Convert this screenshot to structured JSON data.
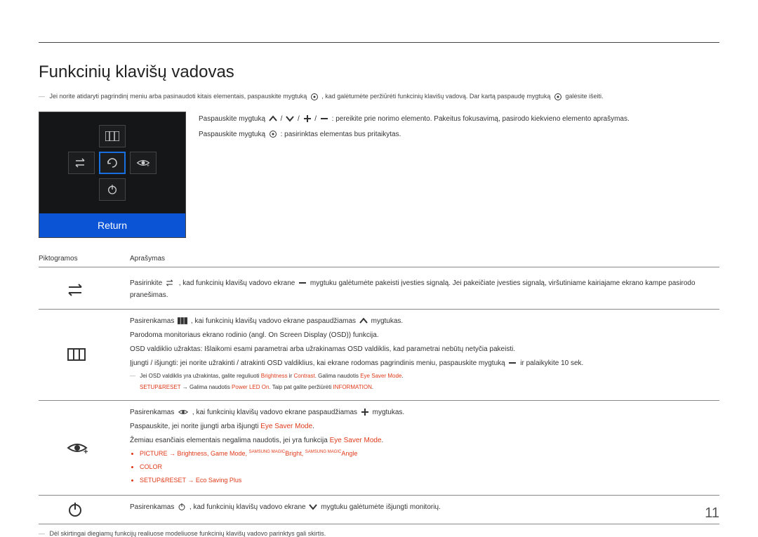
{
  "title": "Funkcinių klavišų vadovas",
  "intro": {
    "part1": "Jei norite atidaryti pagrindinį meniu arba pasinaudoti kitais elementais, paspauskite mygtuką",
    "part2": ", kad galėtumėte peržiūrėti funkcinių klavišų vadovą. Dar kartą paspaudę mygtuką",
    "part3": "galėsite išeiti."
  },
  "panel": {
    "return": "Return"
  },
  "side": {
    "line1_a": "Paspauskite mygtuką",
    "line1_b": ": pereikite prie norimo elemento. Pakeitus fokusavimą, pasirodo kiekvieno elemento aprašymas.",
    "line2_a": "Paspauskite mygtuką",
    "line2_b": ": pasirinktas elementas bus pritaikytas."
  },
  "table": {
    "h_icon": "Piktogramos",
    "h_desc": "Aprašymas",
    "row1": {
      "a": "Pasirinkite",
      "b": ", kad funkcinių klavišų vadovo ekrane",
      "c": "mygtuku galėtumėte pakeisti įvesties signalą. Jei pakeičiate įvesties signalą, viršutiniame kairiajame ekrano kampe pasirodo pranešimas."
    },
    "row2": {
      "a": "Pasirenkamas",
      "b": ", kai funkcinių klavišų vadovo ekrane paspaudžiamas",
      "c": "mygtukas.",
      "line2": "Parodoma monitoriaus ekrano rodinio (angl. On Screen Display (OSD)) funkcija.",
      "line3": "OSD valdiklio užraktas: Išlaikomi esami parametrai arba užrakinamas OSD valdiklis, kad parametrai nebūtų netyčia pakeisti.",
      "line4_a": "Įjungti / išjungti: jei norite užrakinti / atrakinti OSD valdiklius, kai ekrane rodomas pagrindinis meniu, paspauskite mygtuką",
      "line4_b": "ir palaikykite 10 sek.",
      "note_a": "Jei OSD valdiklis yra užrakintas, galite reguliuoti",
      "note_b": "Brightness",
      "note_c": "ir",
      "note_d": "Contrast",
      "note_e": ". Galima naudotis",
      "note_f": "Eye Saver Mode",
      "note2_a": "SETUP&RESET",
      "note2_b": "→ Galima naudotis",
      "note2_c": "Power LED On",
      "note2_d": ". Taip pat galite peržiūrėti",
      "note2_e": "INFORMATION"
    },
    "row3": {
      "a": "Pasirenkamas",
      "b": ", kai funkcinių klavišų vadovo ekrane paspaudžiamas",
      "c": "mygtukas.",
      "line2_a": "Paspauskite, jei norite įjungti arba išjungti",
      "line2_b": "Eye Saver Mode",
      "line3_a": "Žemiau esančiais elementais negalima naudotis, jei yra funkcija",
      "line3_b": "Eye Saver Mode",
      "b1": "PICTURE → Brightness, Game Mode, ",
      "b1s": "SAMSUNG MAGIC",
      "b1t": "Bright, ",
      "b1u": "SAMSUNG MAGIC",
      "b1v": "Angle",
      "b2": "COLOR",
      "b3": "SETUP&RESET → Eco Saving Plus"
    },
    "row4": {
      "a": "Pasirenkamas",
      "b": ", kad funkcinių klavišų vadovo ekrane",
      "c": "mygtuku galėtumėte išjungti monitorių."
    }
  },
  "footnote": "Dėl skirtingai diegiamų funkcijų realiuose modeliuose funkcinių klavišų vadovo parinktys gali skirtis.",
  "page_number": "11"
}
